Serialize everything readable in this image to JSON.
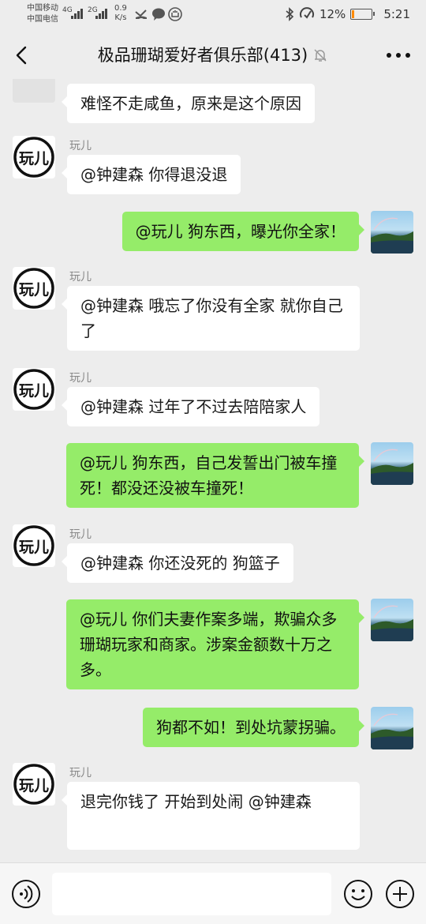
{
  "status_bar": {
    "carrier_1": "中国移动",
    "carrier_2": "中国电信",
    "net_1": "4G",
    "net_2": "2G",
    "speed_value": "0.9",
    "speed_unit": "K/s",
    "battery_text": "12%",
    "battery_level": 0.12,
    "time": "5:21"
  },
  "header": {
    "title": "极品珊瑚爱好者俱乐部(413)"
  },
  "avatar_glyph": "玩儿",
  "messages": [
    {
      "side": "in",
      "partial": true,
      "text": "难怪不走咸鱼，原来是这个原因"
    },
    {
      "side": "in",
      "sender": "玩儿",
      "text": "@钟建森  你得退没退"
    },
    {
      "side": "out",
      "text": "@玩儿  狗东西，曝光你全家！"
    },
    {
      "side": "in",
      "sender": "玩儿",
      "text": "@钟建森  哦忘了你没有全家  就你自己了"
    },
    {
      "side": "in",
      "sender": "玩儿",
      "text": "@钟建森  过年了不过去陪陪家人"
    },
    {
      "side": "out",
      "text": "@玩儿  狗东西，自己发誓出门被车撞死！都没还没被车撞死！"
    },
    {
      "side": "in",
      "sender": "玩儿",
      "text": "@钟建森  你还没死的  狗篮子"
    },
    {
      "side": "out",
      "text": "@玩儿  你们夫妻作案多端，欺骗众多珊瑚玩家和商家。涉案金额数十万之多。"
    },
    {
      "side": "out",
      "text": "狗都不如！到处坑蒙拐骗。"
    },
    {
      "side": "in",
      "sender": "玩儿",
      "text": "退完你钱了  开始到处闹  @钟建森"
    }
  ],
  "input": {
    "placeholder": ""
  },
  "colors": {
    "background": "#ededed",
    "outgoing_bubble": "#95ec69",
    "incoming_bubble": "#ffffff",
    "battery_low": "#ff8a00"
  },
  "icons": {
    "back": "chevron-left-icon",
    "mute": "bell-off-icon",
    "more": "more-dots-icon",
    "voice": "voice-icon",
    "emoji": "emoji-icon",
    "plus": "plus-icon"
  }
}
